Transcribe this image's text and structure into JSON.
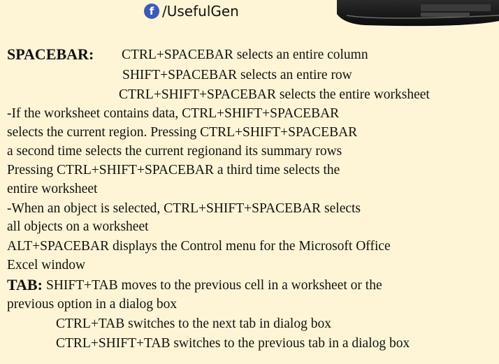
{
  "brand": {
    "icon": "facebook-icon",
    "icon_glyph": "f",
    "text": "/UsefulGen",
    "accent": "#3b5bb6"
  },
  "background": "#fdf5d6",
  "spacebar": {
    "heading": "SPACEBAR",
    "heading_suffix": ":",
    "lines": [
      "CTRL+SPACEBAR selects an entire column",
      "SHIFT+SPACEBAR selects an entire row",
      "CTRL+SHIFT+SPACEBAR selects the entire worksheet",
      "-If the worksheet contains data, CTRL+SHIFT+SPACEBAR",
      "selects the current region. Pressing CTRL+SHIFT+SPACEBAR",
      "a second time selects the current regionand its summary rows",
      "Pressing CTRL+SHIFT+SPACEBAR a third time selects the",
      "entire worksheet",
      "-When an object is selected, CTRL+SHIFT+SPACEBAR selects",
      "all objects on a worksheet",
      "ALT+SPACEBAR displays the Control menu for the Microsoft Office",
      "Excel window"
    ]
  },
  "tab": {
    "heading": "TAB:",
    "lines": [
      "SHIFT+TAB moves to the previous cell in a worksheet or the",
      "previous option in a dialog box",
      "CTRL+TAB switches to the next tab in dialog box",
      "CTRL+SHIFT+TAB switches to the previous tab in a dialog box"
    ]
  }
}
